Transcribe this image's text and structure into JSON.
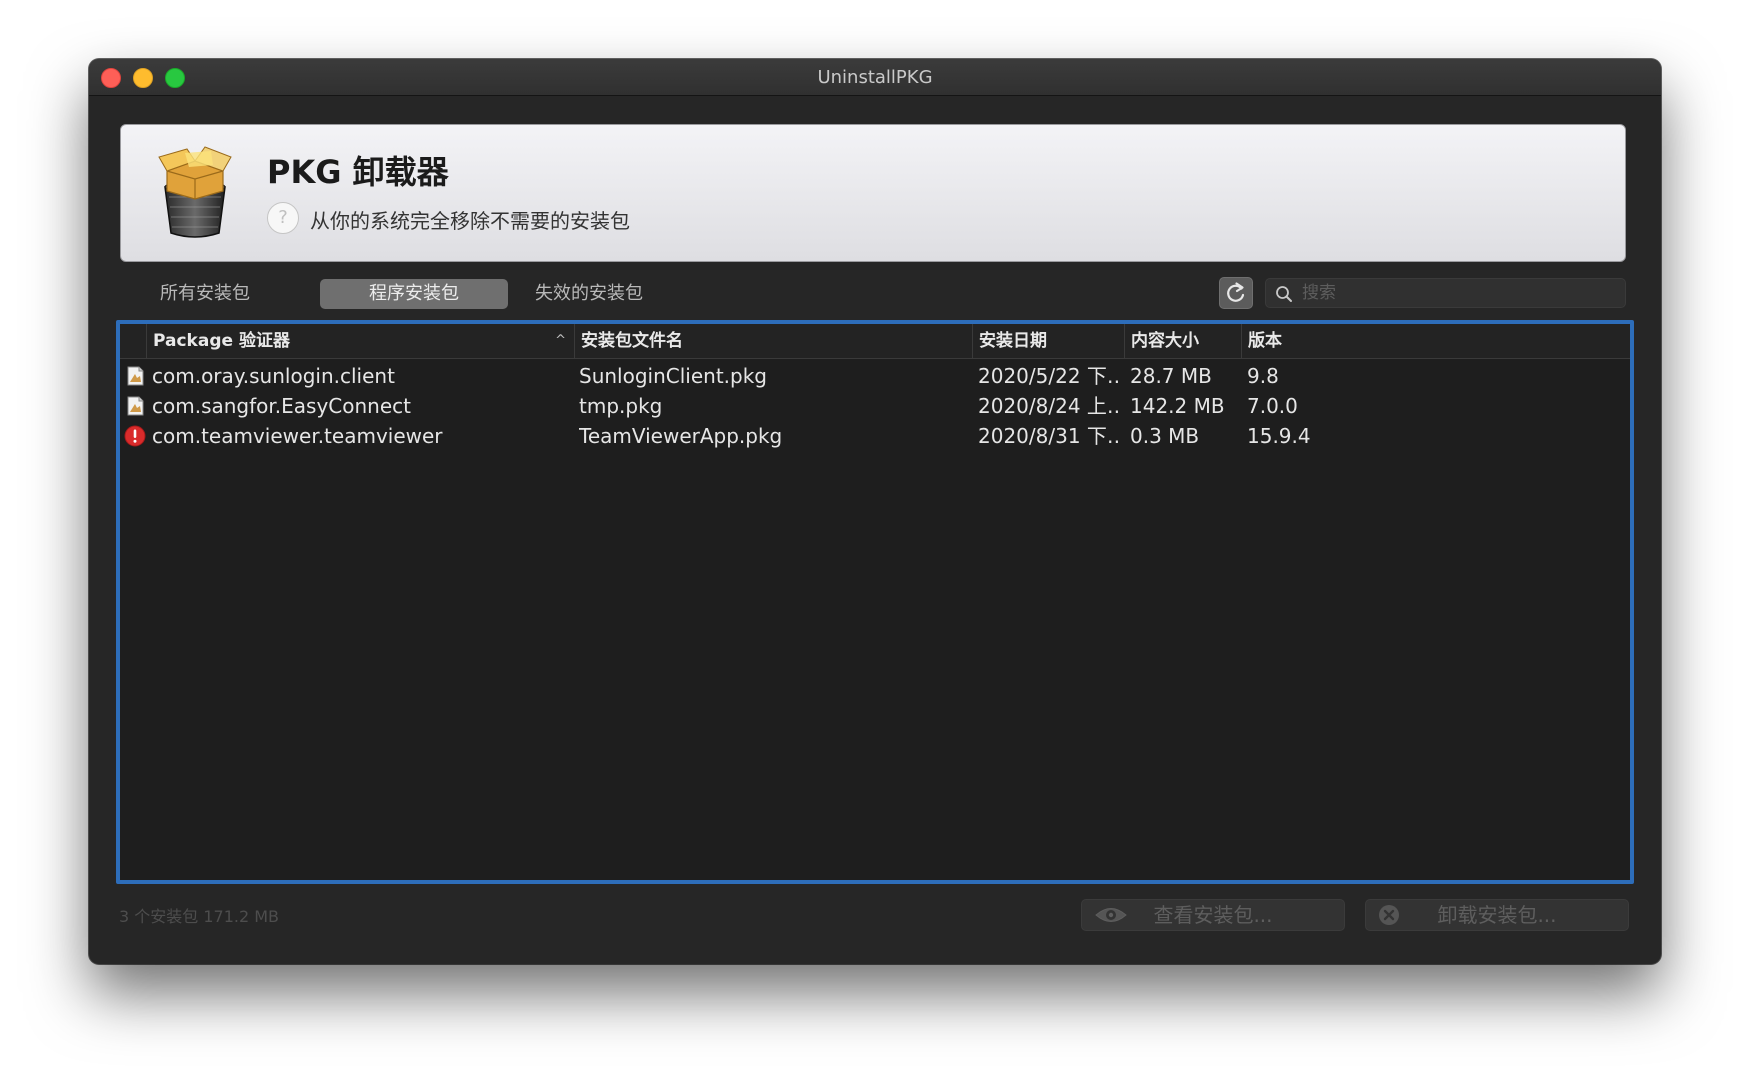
{
  "window": {
    "title": "UninstallPKG"
  },
  "header": {
    "title": "PKG 卸载器",
    "help_label": "?",
    "subtitle": "从你的系统完全移除不需要的安装包"
  },
  "tabs": [
    {
      "label": "所有安装包",
      "selected": false
    },
    {
      "label": "程序安装包",
      "selected": true
    },
    {
      "label": "失效的安装包",
      "selected": false
    }
  ],
  "search": {
    "placeholder": "搜索",
    "value": ""
  },
  "table": {
    "columns": [
      "Package 验证器",
      "安装包文件名",
      "安装日期",
      "内容大小",
      "版本"
    ],
    "sort_indicator": "^",
    "rows": [
      {
        "icon": "package-receipt-icon",
        "id": "com.oray.sunlogin.client",
        "file": "SunloginClient.pkg",
        "date": "2020/5/22 下…",
        "size": "28.7 MB",
        "version": "9.8"
      },
      {
        "icon": "package-receipt-icon",
        "id": "com.sangfor.EasyConnect",
        "file": "tmp.pkg",
        "date": "2020/8/24 上…",
        "size": "142.2 MB",
        "version": "7.0.0"
      },
      {
        "icon": "warning-icon",
        "id": "com.teamviewer.teamviewer",
        "file": "TeamViewerApp.pkg",
        "date": "2020/8/31 下…",
        "size": "0.3 MB",
        "version": "15.9.4"
      }
    ]
  },
  "footer": {
    "status": "3 个安装包  171.2 MB",
    "view_button": "查看安装包...",
    "uninstall_button": "卸载安装包..."
  },
  "colors": {
    "selection_border": "#2d6dba",
    "window_bg": "#262626",
    "warning_red": "#d92b2b"
  }
}
